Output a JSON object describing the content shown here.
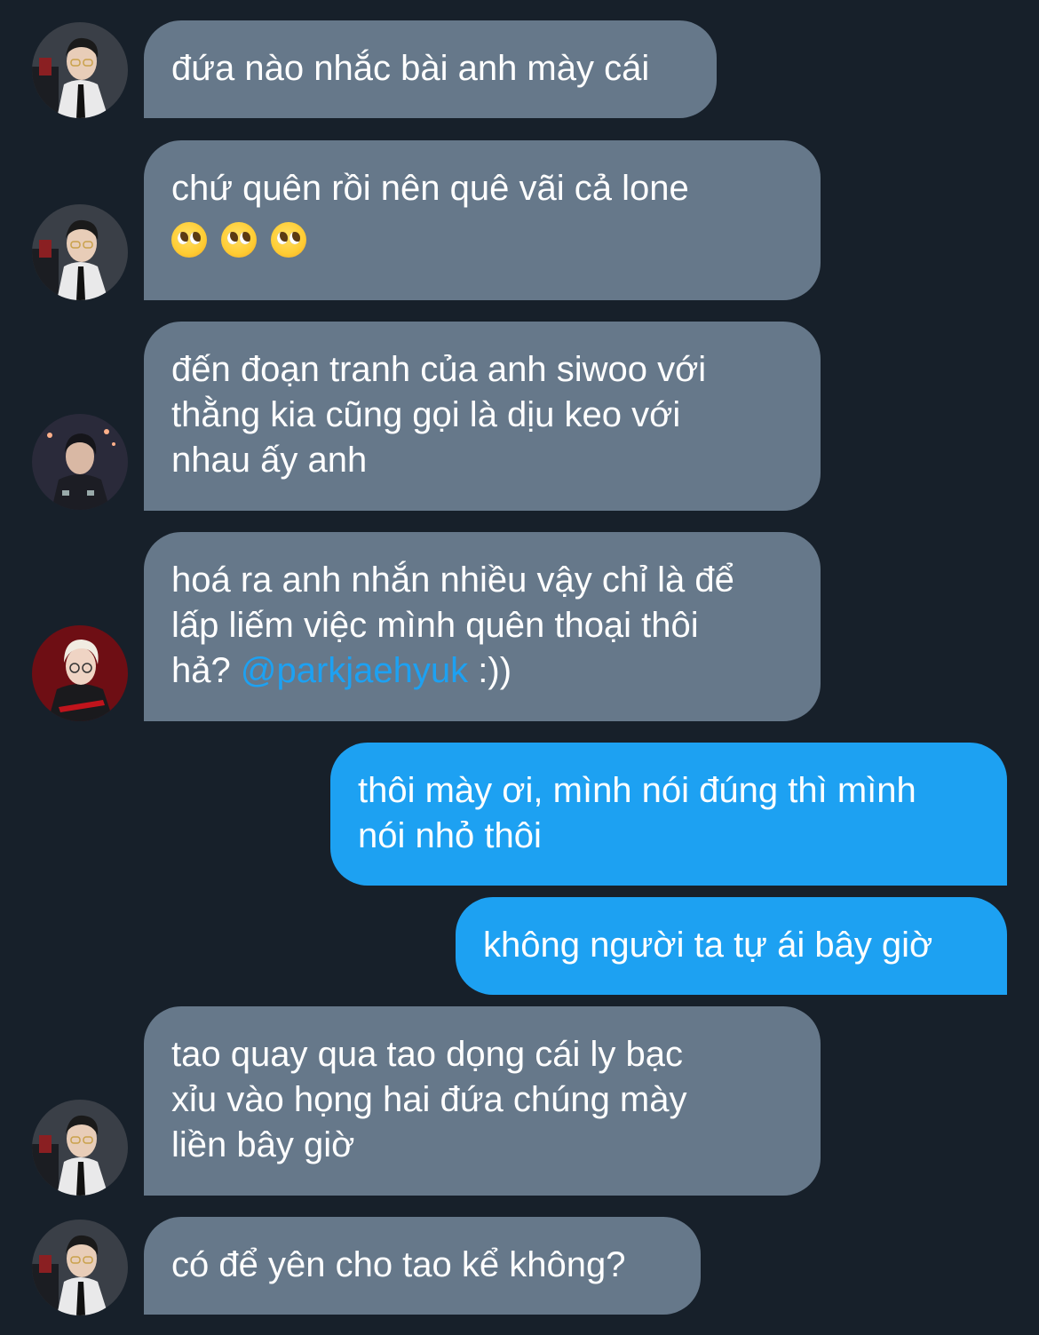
{
  "messages": [
    {
      "side": "in",
      "lines": [
        "đứa nào nhắc bài anh mày cái"
      ]
    },
    {
      "side": "in",
      "lines": [
        "chứ quên rồi nên quê vãi cả lone"
      ],
      "emoji": [
        "pleading-face-emoji",
        "pleading-face-emoji",
        "pleading-face-emoji"
      ]
    },
    {
      "side": "in",
      "lines": [
        "đến đoạn tranh của anh siwoo với",
        "thằng kia cũng gọi là dịu keo với",
        "nhau ấy anh"
      ]
    },
    {
      "side": "in",
      "lines": [
        "hoá ra anh nhắn nhiều vậy chỉ là để",
        "lấp liếm việc mình quên thoại thôi"
      ],
      "last_prefix": "hả? ",
      "mention": "@parkjaehyuk",
      "last_suffix": " :))"
    },
    {
      "side": "out",
      "lines": [
        "thôi mày ơi, mình nói đúng thì mình",
        "nói nhỏ thôi"
      ]
    },
    {
      "side": "out",
      "lines": [
        "không người ta tự ái bây giờ"
      ]
    },
    {
      "side": "in",
      "lines": [
        "tao quay qua tao dọng cái ly bạc",
        "xỉu vào họng hai đứa chúng mày",
        "liền bây giờ"
      ]
    },
    {
      "side": "in",
      "lines": [
        "có để yên cho tao kể không?"
      ]
    }
  ],
  "avatars": [
    "avatar-suit-boy",
    "avatar-suit-boy",
    "avatar-dark-jersey-boy",
    "avatar-blonde-red-jersey-boy",
    "avatar-suit-boy",
    "avatar-suit-boy"
  ],
  "colors": {
    "background": "#17202a",
    "incoming_bubble": "#66788a",
    "outgoing_bubble": "#1da1f2",
    "mention": "#1da1f2",
    "text": "#ffffff"
  }
}
